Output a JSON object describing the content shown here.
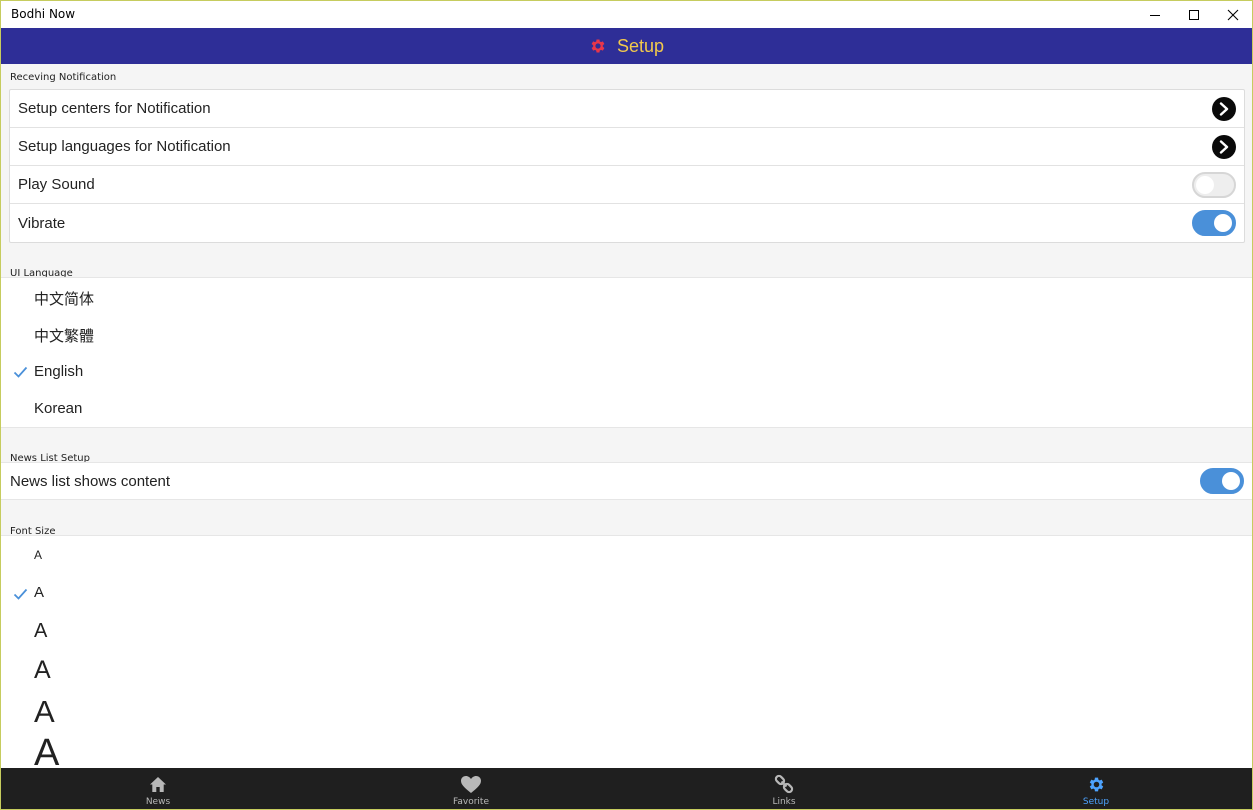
{
  "window": {
    "title": "Bodhi Now"
  },
  "header": {
    "title": "Setup",
    "icon": "gear-icon",
    "icon_color": "#e8364a",
    "title_color": "#f2c94c",
    "background": "#2e2e97"
  },
  "notification": {
    "section_label": "Receving Notification",
    "rows": [
      {
        "label": "Setup centers for Notification",
        "control": "chevron"
      },
      {
        "label": "Setup languages for Notification",
        "control": "chevron"
      },
      {
        "label": "Play Sound",
        "control": "toggle",
        "on": false
      },
      {
        "label": "Vibrate",
        "control": "toggle",
        "on": true
      }
    ]
  },
  "ui_language": {
    "section_label": "UI Language",
    "options": [
      "中文简体",
      "中文繁體",
      "English",
      "Korean"
    ],
    "selected": "English"
  },
  "news_list": {
    "section_label": "News List Setup",
    "row_label": "News list shows content",
    "on": true
  },
  "font_size": {
    "section_label": "Font Size",
    "options": [
      "A",
      "A",
      "A",
      "A",
      "A",
      "A"
    ],
    "selected_index": 1
  },
  "bottom_nav": {
    "items": [
      {
        "label": "News",
        "icon": "home-icon",
        "active": false
      },
      {
        "label": "Favorite",
        "icon": "heart-icon",
        "active": false
      },
      {
        "label": "Links",
        "icon": "link-icon",
        "active": false
      },
      {
        "label": "Setup",
        "icon": "gear-icon",
        "active": true
      }
    ],
    "active_color": "#4da3ff",
    "inactive_color": "#b8b8b8"
  },
  "accent_color": "#4a90d9"
}
